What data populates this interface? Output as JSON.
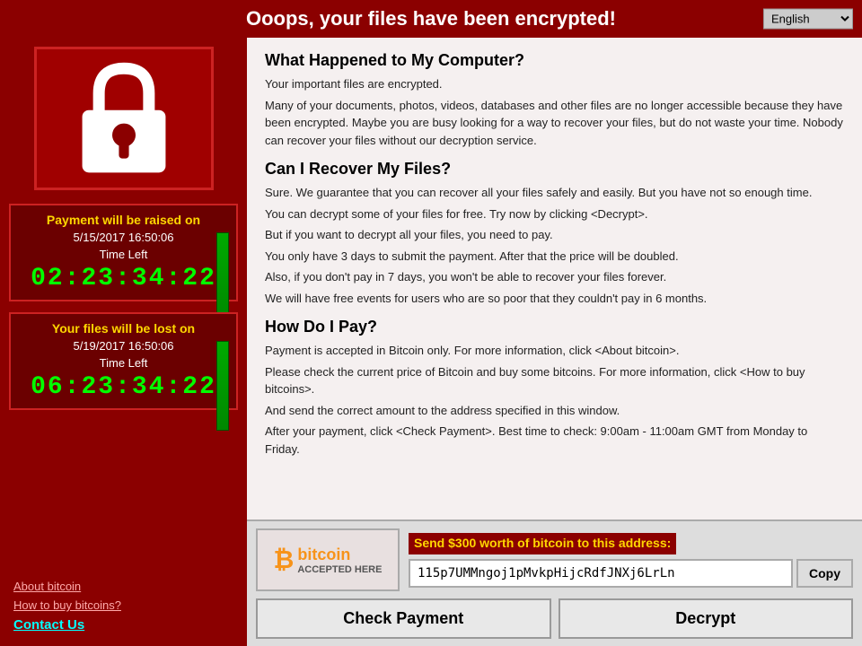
{
  "header": {
    "title": "Ooops, your files have been encrypted!",
    "language_default": "English"
  },
  "left_panel": {
    "timer1": {
      "title": "Payment will be raised on",
      "date": "5/15/2017 16:50:06",
      "time_left_label": "Time Left",
      "countdown": "02:23:34:22"
    },
    "timer2": {
      "title": "Your files will be lost on",
      "date": "5/19/2017 16:50:06",
      "time_left_label": "Time Left",
      "countdown": "06:23:34:22"
    },
    "links": {
      "about_bitcoin": "About bitcoin",
      "how_to_buy": "How to buy bitcoins?",
      "contact_us": "Contact Us"
    }
  },
  "content": {
    "section1_title": "What Happened to My Computer?",
    "section1_p1": "Your important files are encrypted.",
    "section1_p2": "Many of your documents, photos, videos, databases and other files are no longer accessible because they have been encrypted. Maybe you are busy looking for a way to recover your files, but do not waste your time. Nobody can recover your files without our decryption service.",
    "section2_title": "Can I Recover My Files?",
    "section2_p1": "Sure. We guarantee that you can recover all your files safely and easily. But you have not so enough time.",
    "section2_p2": "You can decrypt some of your files for free. Try now by clicking <Decrypt>.",
    "section2_p3": "But if you want to decrypt all your files, you need to pay.",
    "section2_p4": "You only have 3 days to submit the payment. After that the price will be doubled.",
    "section2_p5": "Also, if you don't pay in 7 days, you won't be able to recover your files forever.",
    "section2_p6": "We will have free events for users who are so poor that they couldn't pay in 6 months.",
    "section3_title": "How Do I Pay?",
    "section3_p1": "Payment is accepted in Bitcoin only. For more information, click <About bitcoin>.",
    "section3_p2": "Please check the current price of Bitcoin and buy some bitcoins. For more information, click <How to buy bitcoins>.",
    "section3_p3": "And send the correct amount to the address specified in this window.",
    "section3_p4": "After your payment, click <Check Payment>. Best time to check: 9:00am - 11:00am GMT from Monday to Friday."
  },
  "payment": {
    "bitcoin_label1": "bitcoin",
    "bitcoin_label2": "ACCEPTED HERE",
    "send_label": "Send $300 worth of bitcoin to this address:",
    "address": "115p7UMMngoj1pMvkpHijcRdfJNXj6LrLn",
    "copy_btn": "Copy",
    "check_payment_btn": "Check Payment",
    "decrypt_btn": "Decrypt"
  }
}
